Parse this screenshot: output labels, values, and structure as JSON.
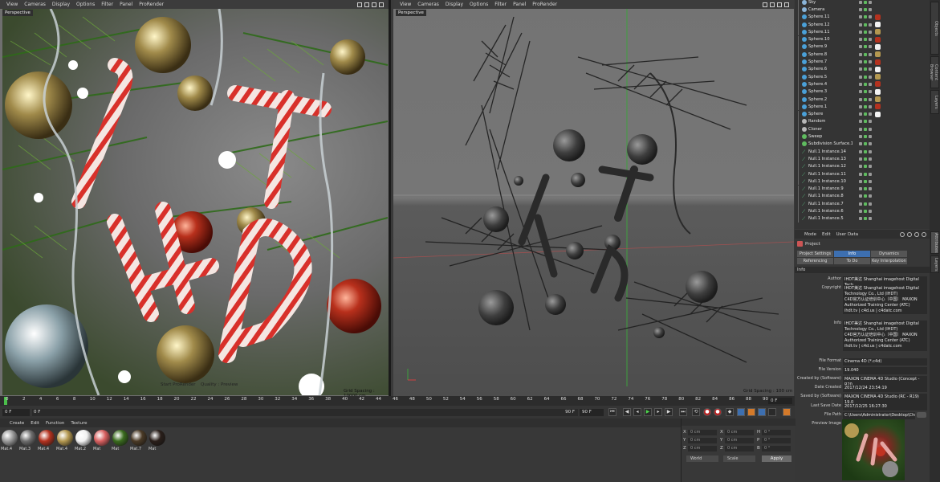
{
  "viewport_left": {
    "menu": [
      "View",
      "Cameras",
      "Display",
      "Options",
      "Filter",
      "Panel",
      "ProRender"
    ],
    "label": "Perspective",
    "status_start": "Start ProRender",
    "status_quality": "Quality : Preview",
    "grid_spacing": "Grid Spacing : 10000 cm"
  },
  "viewport_right": {
    "menu": [
      "View",
      "Cameras",
      "Display",
      "Options",
      "Filter",
      "Panel",
      "ProRender"
    ],
    "label": "Perspective",
    "grid_spacing": "Grid Spacing : 100 cm"
  },
  "object_manager": {
    "objects": [
      {
        "name": "Sky",
        "kind": "sky"
      },
      {
        "name": "Camera",
        "kind": "camera"
      },
      {
        "name": "Sphere.11",
        "kind": "sphere"
      },
      {
        "name": "Sphere.12",
        "kind": "sphere"
      },
      {
        "name": "Sphere.11",
        "kind": "sphere"
      },
      {
        "name": "Sphere.10",
        "kind": "sphere"
      },
      {
        "name": "Sphere.9",
        "kind": "sphere"
      },
      {
        "name": "Sphere.8",
        "kind": "sphere"
      },
      {
        "name": "Sphere.7",
        "kind": "sphere"
      },
      {
        "name": "Sphere.6",
        "kind": "sphere"
      },
      {
        "name": "Sphere.5",
        "kind": "sphere"
      },
      {
        "name": "Sphere.4",
        "kind": "sphere"
      },
      {
        "name": "Sphere.3",
        "kind": "sphere"
      },
      {
        "name": "Sphere.2",
        "kind": "sphere"
      },
      {
        "name": "Sphere.1",
        "kind": "sphere"
      },
      {
        "name": "Sphere",
        "kind": "sphere"
      },
      {
        "name": "Random",
        "kind": "effector"
      },
      {
        "name": "Cloner",
        "kind": "cloner"
      },
      {
        "name": "Sweep",
        "kind": "sweep"
      },
      {
        "name": "Subdivision Surface.1",
        "kind": "subd"
      },
      {
        "name": "Null.1 Instance.14",
        "kind": "null"
      },
      {
        "name": "Null.1 Instance.13",
        "kind": "null"
      },
      {
        "name": "Null.1 Instance.12",
        "kind": "null"
      },
      {
        "name": "Null.1 Instance.11",
        "kind": "null"
      },
      {
        "name": "Null.1 Instance.10",
        "kind": "null"
      },
      {
        "name": "Null.1 Instance.9",
        "kind": "null"
      },
      {
        "name": "Null.1 Instance.8",
        "kind": "null"
      },
      {
        "name": "Null.1 Instance.7",
        "kind": "null"
      },
      {
        "name": "Null.1 Instance.6",
        "kind": "null"
      },
      {
        "name": "Null.1 Instance.5",
        "kind": "null"
      }
    ]
  },
  "attribute_manager": {
    "modes": [
      "Mode",
      "Edit",
      "User Data"
    ],
    "title": "Project",
    "tabs": [
      "Project Settings",
      "Info",
      "Dynamics",
      "Referencing",
      "To Do",
      "Key Interpolation"
    ],
    "active_tab": "Info",
    "section": "Info",
    "fields": {
      "author_label": "Author",
      "author_value": "IHDT美达 Shanghai imagehost Digital Tech",
      "copyright_label": "Copyright",
      "copyright_value": "IHDT美达 Shanghai imagehost Digital Technology Co., Ltd (IHDT)\nC4D官方认证培训中心（中国） MAXON Authorized Training Center (ATC)\nihdt.tv | c4d.us | c4datc.com",
      "info_label": "Info",
      "info_value": "IHDT美达 Shanghai imagehost Digital Technology Co., Ltd (IHDT)\nC4D官方认证培训中心（中国） MAXON Authorized Training Center (ATC)\nihdt.tv | c4d.us | c4datc.com",
      "file_format_label": "File Format",
      "file_format_value": "Cinema 4D (*.c4d)",
      "file_version_label": "File Version",
      "file_version_value": "19.040",
      "created_by_label": "Created by (Software)",
      "created_by_value": "MAXON CINEMA 4D Studio (Concept - R20",
      "date_created_label": "Date Created",
      "date_created_value": "2017/12/24 23:54:19",
      "saved_by_label": "Saved by (Software)",
      "saved_by_value": "MAXON CINEMA 4D Studio (RC - R19) 19.0",
      "last_save_label": "Last Save Date",
      "last_save_value": "2017/12/25 16:27:30",
      "file_path_label": "File Path",
      "file_path_value": "C:\\Users\\Administrator\\Desktop\\Chr",
      "preview_label": "Preview Image"
    }
  },
  "timeline": {
    "ticks": [
      "0",
      "2",
      "4",
      "6",
      "8",
      "10",
      "12",
      "14",
      "16",
      "18",
      "20",
      "22",
      "24",
      "26",
      "28",
      "30",
      "32",
      "34",
      "36",
      "38",
      "40",
      "42",
      "44",
      "46",
      "48",
      "50",
      "52",
      "54",
      "56",
      "58",
      "60",
      "62",
      "64",
      "66",
      "68",
      "70",
      "72",
      "74",
      "76",
      "78",
      "80",
      "82",
      "84",
      "86",
      "88",
      "90"
    ],
    "current_frame": "0 F"
  },
  "transport": {
    "start_field": "0 F",
    "min_field": "0 F",
    "max_field": "90 F",
    "end_field": "90 F"
  },
  "material_manager": {
    "menu": [
      "Create",
      "Edit",
      "Function",
      "Texture"
    ],
    "materials": [
      {
        "label": "Mat.4",
        "color": "#9a9a9a"
      },
      {
        "label": "Mat.3",
        "color": "#6e6e6e"
      },
      {
        "label": "Mat.4",
        "color": "#b4321f"
      },
      {
        "label": "Mat.4",
        "color": "#b49850"
      },
      {
        "label": "Mat.2",
        "color": "#f2f2f2"
      },
      {
        "label": "Mat",
        "color": "#d86060"
      },
      {
        "label": "Mat",
        "color": "#3a6b1e"
      },
      {
        "label": "Mat.7",
        "color": "#4a3a26"
      },
      {
        "label": "Mat",
        "color": "#2a1f1a"
      }
    ]
  },
  "coordinates": {
    "rows": [
      {
        "axis": "X",
        "pos": "0 cm",
        "axis2": "X",
        "size": "0 cm",
        "axis3": "H",
        "rot": "0 °"
      },
      {
        "axis": "Y",
        "pos": "0 cm",
        "axis2": "Y",
        "size": "0 cm",
        "axis3": "P",
        "rot": "0 °"
      },
      {
        "axis": "Z",
        "pos": "0 cm",
        "axis2": "Z",
        "size": "0 cm",
        "axis3": "B",
        "rot": "0 °"
      }
    ],
    "mode1": "World",
    "mode2": "Scale",
    "apply": "Apply"
  },
  "side_tabs": [
    "Objects",
    "Content Browser",
    "Layers",
    "Attributes",
    "Layers"
  ]
}
